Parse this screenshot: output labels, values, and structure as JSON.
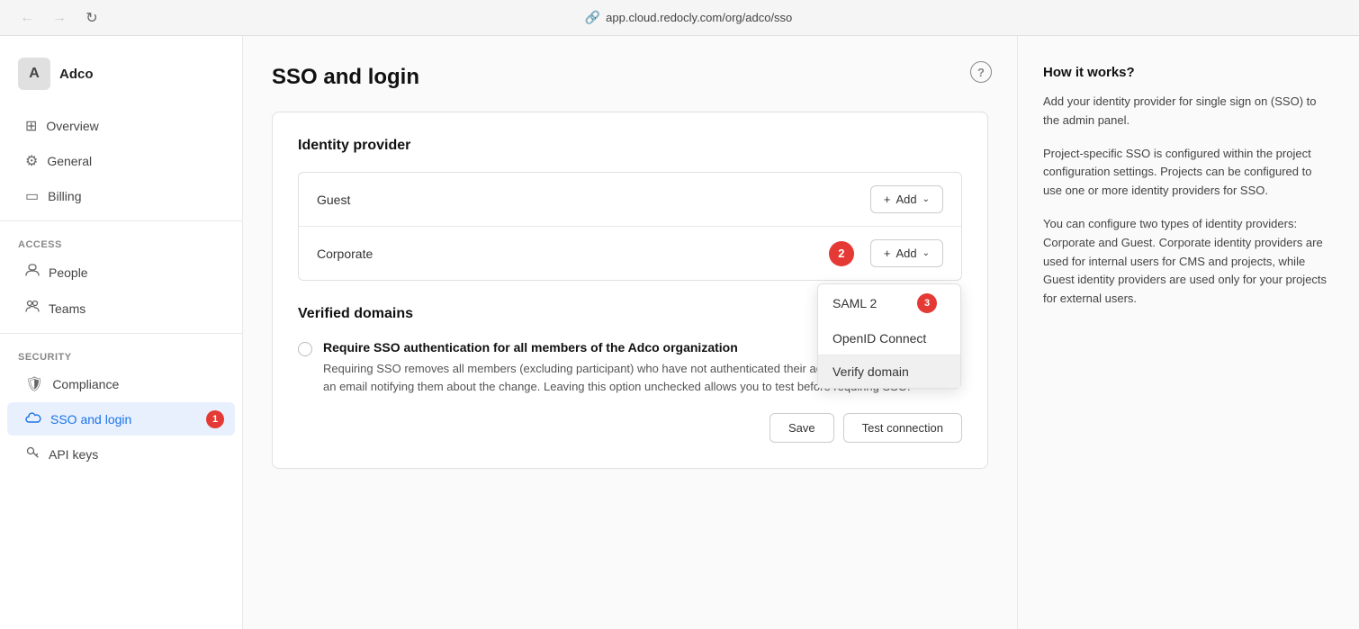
{
  "topbar": {
    "url": "app.cloud.redocly.com/org/adco/sso",
    "back_title": "Back",
    "forward_title": "Forward",
    "refresh_title": "Refresh"
  },
  "sidebar": {
    "org_name": "Adco",
    "org_initial": "A",
    "items_top": [
      {
        "id": "overview",
        "label": "Overview",
        "icon": "⊞"
      },
      {
        "id": "general",
        "label": "General",
        "icon": "⚙"
      },
      {
        "id": "billing",
        "label": "Billing",
        "icon": "▭"
      }
    ],
    "section_access": "Access",
    "items_access": [
      {
        "id": "people",
        "label": "People",
        "icon": "👤"
      },
      {
        "id": "teams",
        "label": "Teams",
        "icon": "👥"
      }
    ],
    "section_security": "Security",
    "items_security": [
      {
        "id": "compliance",
        "label": "Compliance",
        "icon": "🛡"
      },
      {
        "id": "sso",
        "label": "SSO and login",
        "icon": "☁",
        "active": true,
        "badge": "1"
      },
      {
        "id": "apikeys",
        "label": "API keys",
        "icon": "🔑"
      }
    ]
  },
  "page": {
    "title": "SSO and login",
    "help_label": "?"
  },
  "card": {
    "identity_provider_label": "Identity provider",
    "rows": [
      {
        "id": "guest",
        "label": "Guest",
        "badge": null
      },
      {
        "id": "corporate",
        "label": "Corporate",
        "badge": "2"
      }
    ],
    "add_button_label": "+ Add",
    "add_plus": "+",
    "add_text": "Add",
    "chevron": "∨",
    "dropdown": {
      "items": [
        {
          "id": "saml2",
          "label": "SAML 2",
          "badge": "3"
        },
        {
          "id": "openid",
          "label": "OpenID Connect"
        },
        {
          "id": "verify",
          "label": "Verify domain",
          "highlighted": true
        }
      ]
    },
    "verified_domains_label": "Verified domains",
    "sso_title": "Require SSO authentication for all members of the Adco organization",
    "sso_desc": "Requiring SSO removes all members (excluding participant) who have not authenticated their accounts. Members receive an email notifying them about the change. Leaving this option unchecked allows you to test before requiring SSO.",
    "save_label": "Save",
    "test_label": "Test connection"
  },
  "right_panel": {
    "title": "How it works?",
    "paragraphs": [
      "Add your identity provider for single sign on (SSO) to the admin panel.",
      "Project-specific SSO is configured within the project configuration settings. Projects can be configured to use one or more identity providers for SSO.",
      "You can configure two types of identity providers: Corporate and Guest. Corporate identity providers are used for internal users for CMS and projects, while Guest identity providers are used only for your projects for external users."
    ]
  }
}
